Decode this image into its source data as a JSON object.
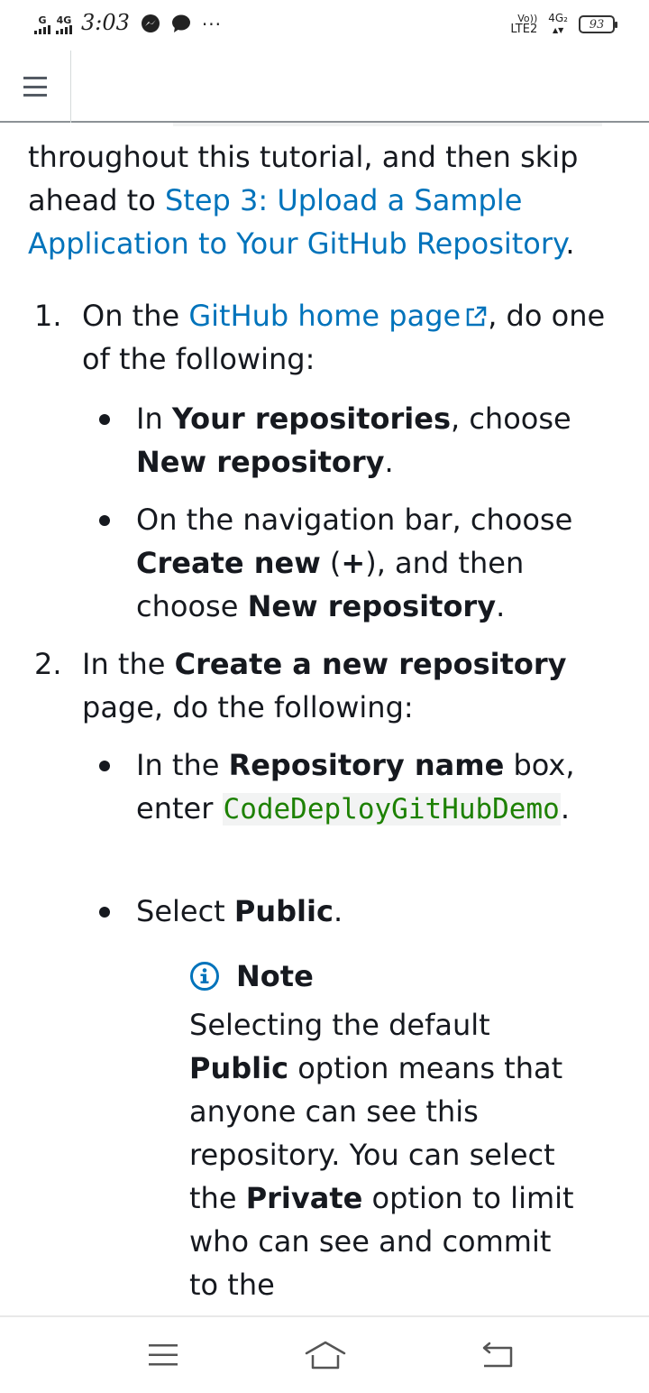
{
  "status_bar": {
    "sim1_label": "G",
    "sim2_label": "4G",
    "time": "3:03",
    "overflow": "···",
    "volte_top": "Vo))",
    "volte_bottom": "LTE2",
    "net_label": "4G₂",
    "battery": "93"
  },
  "header": {
    "menu_icon": "hamburger-menu-icon"
  },
  "intro": {
    "text_before": "throughout this tutorial, and then skip ahead to ",
    "link": "Step 3: Upload a Sample Application to Your GitHub Repository",
    "text_after": "."
  },
  "step1": {
    "number": "1.",
    "prefix": "On the ",
    "link": "GitHub home page",
    "suffix": ", do one of the following:",
    "bullet1": {
      "a": "In ",
      "b1": "Your repositories",
      "c": ", choose ",
      "b2": "New repository",
      "d": "."
    },
    "bullet2": {
      "a": "On the navigation bar, choose ",
      "b1": "Create new",
      "c1": " (",
      "plus": "+",
      "c2": "), and then choose ",
      "b2": "New repository",
      "d": "."
    }
  },
  "step2": {
    "number": "2.",
    "prefix": "In the ",
    "bold": "Create a new repository",
    "suffix": " page, do the following:",
    "bullet1": {
      "a": "In the ",
      "b1": "Repository name",
      "c": " box, enter ",
      "code": "CodeDeployGitHubDemo",
      "d": "."
    },
    "bullet2": {
      "a": "Select ",
      "b1": "Public",
      "d": "."
    }
  },
  "note": {
    "icon": "info-icon",
    "title": "Note",
    "p1": "Selecting the default ",
    "b1": "Public",
    "p2": " option means that anyone can see this repository. You can select the ",
    "b2": "Private",
    "p3": " option to limit who can see and commit to the"
  },
  "nav_bar": {
    "recents": "recents-icon",
    "home": "home-icon",
    "back": "back-icon"
  }
}
